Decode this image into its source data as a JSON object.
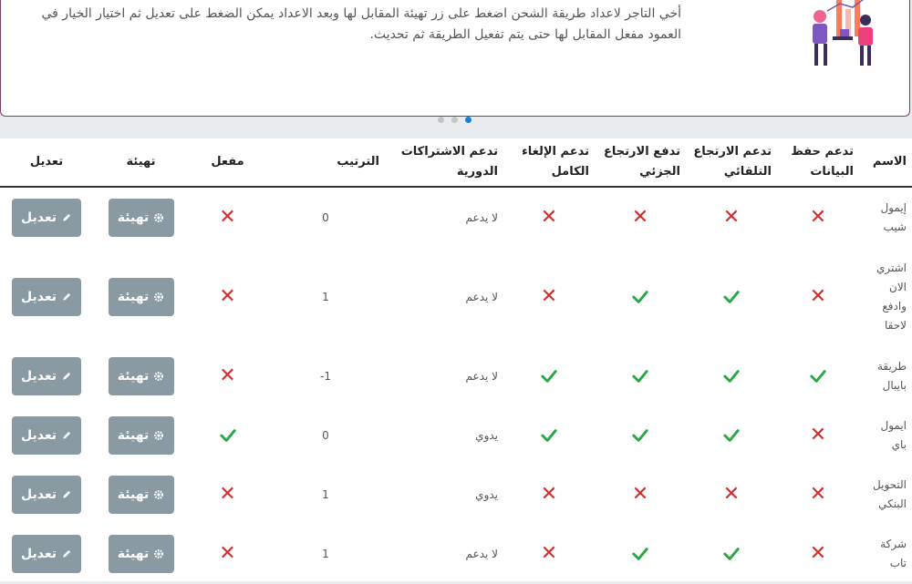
{
  "info": {
    "text": "أخي التاجر لاعداد طريقة الشحن اضغط على زر تهيئة المقابل لها وبعد الاعداد يمكن الضغط على تعديل ثم اختيار الخيار في العمود مفعل المقابل لها حتى يتم تفعيل الطريقة ثم تحديث."
  },
  "table": {
    "headers": {
      "name": "الاسم",
      "data_save": "تدعم حفظ البيانات",
      "auto_refund": "تدعم الارتجاع التلقائي",
      "partial_refund": "تدفع الارتجاع الجزئي",
      "full_cancel": "تدعم الإلغاء الكامل",
      "subscriptions": "تدعم الاشتراكات الدورية",
      "order": "الترتيب",
      "active": "مفعل",
      "setup": "تهيئة",
      "edit": "تعديل"
    },
    "setup_label": "تهيئة",
    "edit_label": "تعديل",
    "rows": [
      {
        "name": "إيمول شيب",
        "data_save": "no",
        "auto_refund": "no",
        "partial_refund": "no",
        "full_cancel": "no",
        "subscriptions": "لا يدعم",
        "order": "0",
        "active": "no"
      },
      {
        "name": "اشتري الان وادفع لاحقا",
        "data_save": "no",
        "auto_refund": "yes",
        "partial_refund": "yes",
        "full_cancel": "no",
        "subscriptions": "لا يدعم",
        "order": "1",
        "active": "no"
      },
      {
        "name": "طريقة بايبال",
        "data_save": "yes",
        "auto_refund": "yes",
        "partial_refund": "yes",
        "full_cancel": "yes",
        "subscriptions": "لا يدعم",
        "order": "1-",
        "active": "no"
      },
      {
        "name": "ايمول باي",
        "data_save": "no",
        "auto_refund": "yes",
        "partial_refund": "yes",
        "full_cancel": "yes",
        "subscriptions": "يدوي",
        "order": "0",
        "active": "yes"
      },
      {
        "name": "التحويل البنكي",
        "data_save": "no",
        "auto_refund": "no",
        "partial_refund": "no",
        "full_cancel": "no",
        "subscriptions": "يدوي",
        "order": "1",
        "active": "no"
      },
      {
        "name": "شركة تاب",
        "data_save": "no",
        "auto_refund": "yes",
        "partial_refund": "yes",
        "full_cancel": "no",
        "subscriptions": "لا يدعم",
        "order": "1",
        "active": "no"
      }
    ]
  },
  "colors": {
    "check": "#28a745",
    "cross": "#d32f2f",
    "button": "#8a9aa3",
    "dot_active": "#1e7fd6",
    "card_border": "#7e3f6f"
  },
  "icons": {
    "yes": "check-icon",
    "no": "x-icon",
    "setup": "gear-icon",
    "edit": "pencil-icon"
  }
}
